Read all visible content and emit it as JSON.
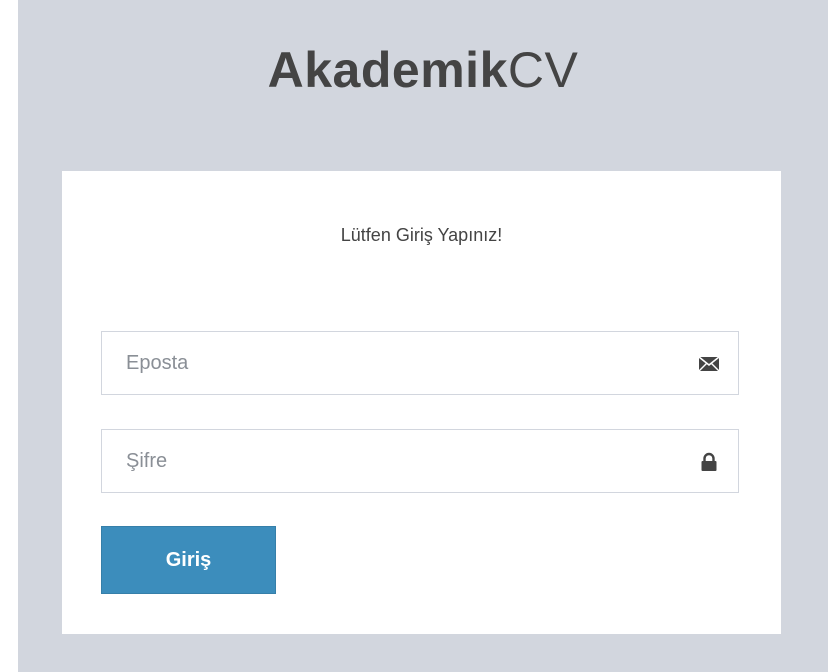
{
  "logo": {
    "bold": "Akademik",
    "light": "CV"
  },
  "login": {
    "message": "Lütfen Giriş Yapınız!",
    "email_placeholder": "Eposta",
    "password_placeholder": "Şifre",
    "submit_label": "Giriş"
  },
  "icons": {
    "email": "envelope-icon",
    "password": "lock-icon"
  },
  "colors": {
    "background": "#d2d6de",
    "card": "#ffffff",
    "primary_button": "#3c8dbc",
    "text": "#444444"
  }
}
